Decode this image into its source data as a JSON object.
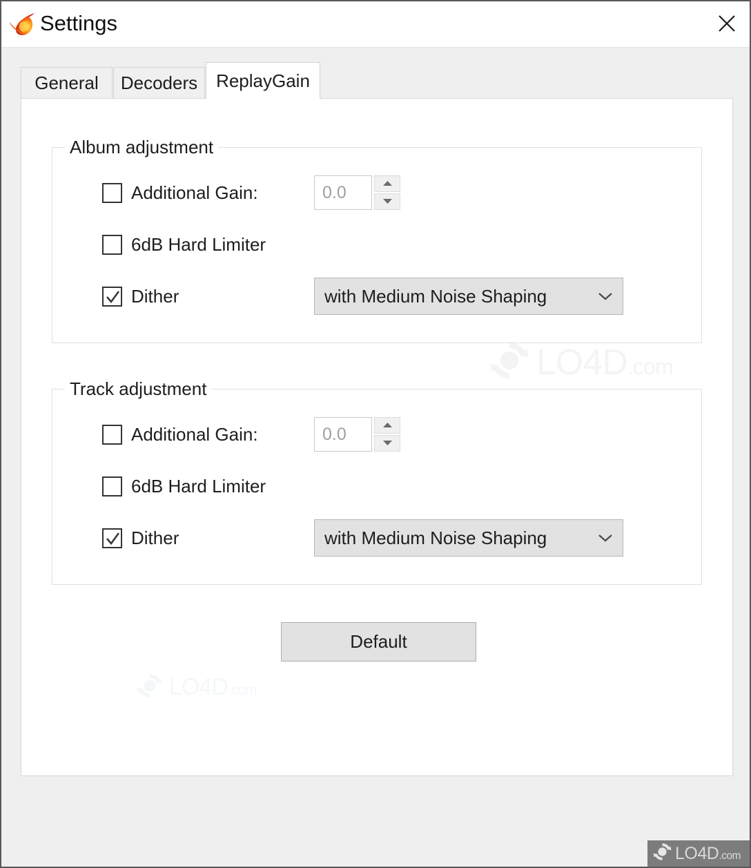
{
  "window": {
    "title": "Settings",
    "icon": "flame-comet-icon",
    "close_icon": "close-icon"
  },
  "tabs": [
    {
      "label": "General",
      "active": false
    },
    {
      "label": "Decoders",
      "active": false
    },
    {
      "label": "ReplayGain",
      "active": true
    }
  ],
  "groups": [
    {
      "legend": "Album adjustment",
      "additional_gain": {
        "label": "Additional Gain:",
        "checked": false,
        "value": "0.0",
        "placeholder": "0.0"
      },
      "hard_limiter": {
        "label": "6dB Hard Limiter",
        "checked": false
      },
      "dither": {
        "label": "Dither",
        "checked": true,
        "selected": "with Medium Noise Shaping"
      }
    },
    {
      "legend": "Track adjustment",
      "additional_gain": {
        "label": "Additional Gain:",
        "checked": false,
        "value": "0.0",
        "placeholder": "0.0"
      },
      "hard_limiter": {
        "label": "6dB Hard Limiter",
        "checked": false
      },
      "dither": {
        "label": "Dither",
        "checked": true,
        "selected": "with Medium Noise Shaping"
      }
    }
  ],
  "default_button": {
    "label": "Default"
  },
  "watermark": {
    "brand": "LO4D",
    "suffix": ".com"
  },
  "colors": {
    "window_border": "#585858",
    "titlebar_bg": "#ffffff",
    "dialog_bg": "#efefef",
    "panel_bg": "#ffffff",
    "tab_inactive_bg": "#f0f0f0",
    "control_bg": "#e2e2e2",
    "text": "#1d1d1d",
    "disabled_text": "#a0a0a0",
    "group_border": "#e0e0e0",
    "badge_bg": "#7c7c7c"
  }
}
